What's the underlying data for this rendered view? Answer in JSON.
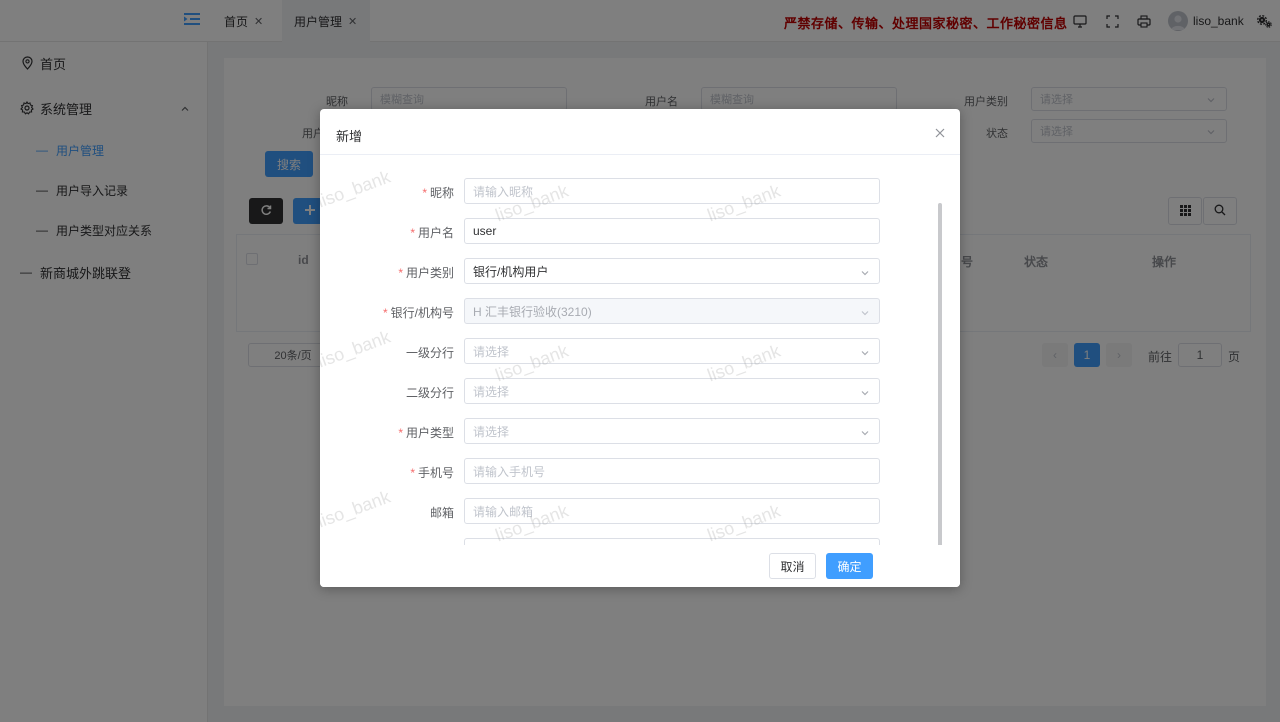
{
  "colors": {
    "accent": "#409eff",
    "warning": "#c00000",
    "required": "#f56c6c",
    "mask": "rgba(0,0,0,0.5)"
  },
  "sidebar": {
    "items": [
      {
        "label": "首页",
        "icon": "location-pin-icon"
      },
      {
        "label": "系统管理",
        "icon": "gear-icon",
        "expanded": true,
        "children": [
          {
            "label": "用户管理",
            "active": true
          },
          {
            "label": "用户导入记录"
          },
          {
            "label": "用户类型对应关系"
          }
        ]
      },
      {
        "label": "新商城外跳联登"
      }
    ]
  },
  "topbar": {
    "tabs": [
      {
        "label": "首页"
      },
      {
        "label": "用户管理",
        "active": true
      }
    ],
    "warning": "严禁存储、传输、处理国家秘密、工作秘密信息",
    "username": "liso_bank"
  },
  "main": {
    "filters": {
      "nickname_label": "昵称",
      "nickname_placeholder": "模糊查询",
      "username_label": "用户名",
      "username_placeholder": "模糊查询",
      "category_label": "用户类别",
      "category_placeholder": "请选择",
      "row2_label_partial": "用户",
      "status_label": "状态",
      "status_placeholder": "请选择"
    },
    "search_button": "搜索",
    "table_headers": {
      "id": "id",
      "no_partial": "号",
      "status": "状态",
      "actions": "操作"
    },
    "pagination": {
      "page_size": "20条/页",
      "current_page": "1",
      "goto_label": "前往",
      "goto_value": "1",
      "page_unit": "页"
    }
  },
  "watermark": "liso_bank",
  "dialog": {
    "title": "新增",
    "fields": [
      {
        "label": "昵称",
        "required": true,
        "value": "",
        "placeholder": "请输入昵称",
        "type": "text"
      },
      {
        "label": "用户名",
        "required": true,
        "value": "user",
        "placeholder": "",
        "type": "text"
      },
      {
        "label": "用户类别",
        "required": true,
        "value": "银行/机构用户",
        "placeholder": "",
        "type": "select"
      },
      {
        "label": "银行/机构号",
        "required": true,
        "value": "H 汇丰银行验收(3210)",
        "placeholder": "",
        "type": "select",
        "disabled": true
      },
      {
        "label": "一级分行",
        "required": false,
        "value": "",
        "placeholder": "请选择",
        "type": "select"
      },
      {
        "label": "二级分行",
        "required": false,
        "value": "",
        "placeholder": "请选择",
        "type": "select"
      },
      {
        "label": "用户类型",
        "required": true,
        "value": "",
        "placeholder": "请选择",
        "type": "select"
      },
      {
        "label": "手机号",
        "required": true,
        "value": "",
        "placeholder": "请输入手机号",
        "type": "text"
      },
      {
        "label": "邮箱",
        "required": false,
        "value": "",
        "placeholder": "请输入邮箱",
        "type": "text"
      }
    ],
    "cancel_label": "取消",
    "confirm_label": "确定"
  }
}
